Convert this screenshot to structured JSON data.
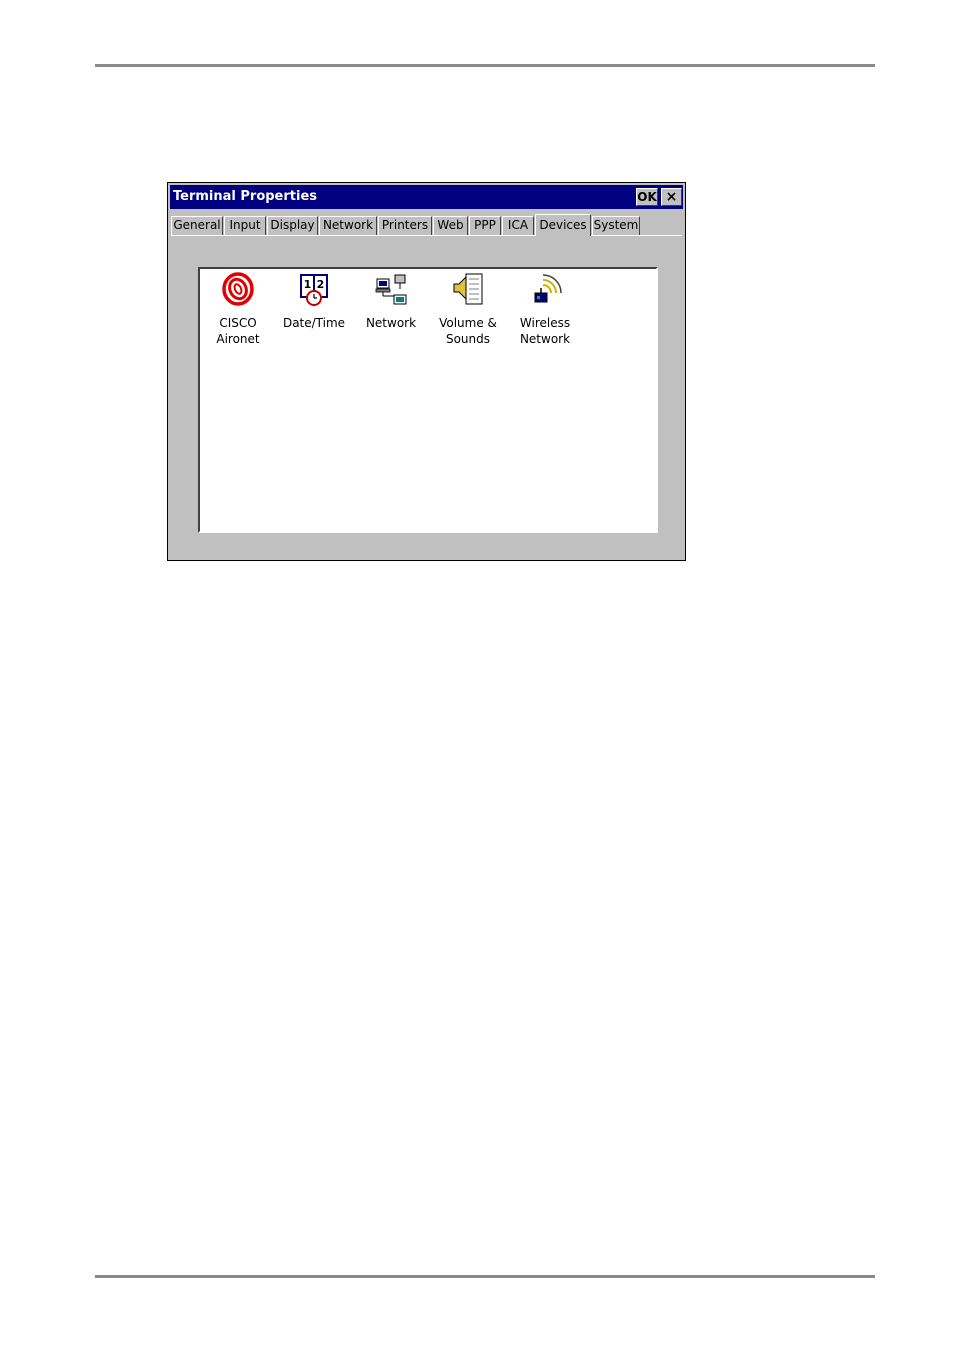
{
  "window": {
    "title": "Terminal Properties",
    "ok_label": "OK",
    "close_label": "×"
  },
  "tabs": [
    {
      "label": "General"
    },
    {
      "label": "Input"
    },
    {
      "label": "Display"
    },
    {
      "label": "Network"
    },
    {
      "label": "Printers"
    },
    {
      "label": "Web"
    },
    {
      "label": "PPP"
    },
    {
      "label": "ICA"
    },
    {
      "label": "Devices",
      "active": true
    },
    {
      "label": "System"
    }
  ],
  "devices": [
    {
      "line1": "CISCO",
      "line2": "Aironet",
      "icon": "cisco-aironet-icon"
    },
    {
      "line1": "Date/Time",
      "line2": "",
      "icon": "date-time-icon"
    },
    {
      "line1": "Network",
      "line2": "",
      "icon": "network-icon"
    },
    {
      "line1": "Volume &",
      "line2": "Sounds",
      "icon": "volume-sounds-icon"
    },
    {
      "line1": "Wireless",
      "line2": "Network",
      "icon": "wireless-network-icon"
    }
  ],
  "colors": {
    "titlebar": "#000080",
    "face": "#c0c0c0",
    "cisco_red": "#e00000"
  }
}
